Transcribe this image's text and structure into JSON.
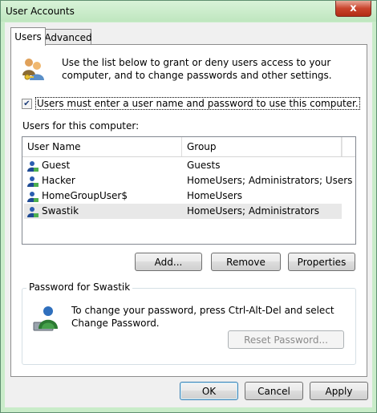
{
  "window": {
    "title": "User Accounts",
    "close_label": "x"
  },
  "tabs": [
    {
      "label": "Users"
    },
    {
      "label": "Advanced"
    }
  ],
  "intro": {
    "text": "Use the list below to grant or deny users access to your computer, and to change passwords and other settings."
  },
  "require_login": {
    "label": "Users must enter a user name and password to use this computer.",
    "checked": true
  },
  "users_section": {
    "label": "Users for this computer:"
  },
  "table": {
    "columns": [
      "User Name",
      "Group"
    ],
    "rows": [
      {
        "name": "Guest",
        "group": "Guests"
      },
      {
        "name": "Hacker",
        "group": "HomeUsers; Administrators; Users"
      },
      {
        "name": "HomeGroupUser$",
        "group": "HomeUsers"
      },
      {
        "name": "Swastik",
        "group": "HomeUsers; Administrators"
      }
    ],
    "selected_index": 3
  },
  "user_buttons": {
    "add": "Add...",
    "remove": "Remove",
    "properties": "Properties"
  },
  "password_group": {
    "title": "Password for Swastik",
    "text": "To change your password, press Ctrl-Alt-Del and select Change Password.",
    "reset_label": "Reset Password..."
  },
  "dialog_buttons": {
    "ok": "OK",
    "cancel": "Cancel",
    "apply": "Apply"
  }
}
